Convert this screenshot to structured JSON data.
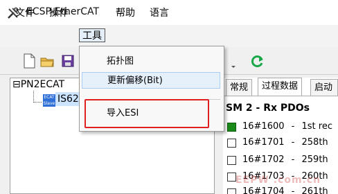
{
  "window": {
    "title": "ECSP-EtherCAT",
    "app_icon": "tools-icon"
  },
  "menubar": {
    "items": [
      {
        "label": "文件"
      },
      {
        "label": "操作"
      },
      {
        "label": "工具"
      },
      {
        "label": "帮助"
      },
      {
        "label": "语言"
      }
    ]
  },
  "toolbar": {
    "icons": [
      "new-file-icon",
      "open-folder-icon",
      "save-icon",
      "refresh-icon"
    ]
  },
  "tools_menu": {
    "items": [
      {
        "label": "拓扑图"
      },
      {
        "label": "更新偏移(Bit)"
      },
      {
        "label": "导入ESI"
      }
    ]
  },
  "tree": {
    "root_label": "PN2ECAT",
    "child_label": "IS62",
    "device_icon_text": "ECAT Slave"
  },
  "right_panel": {
    "tabs": [
      {
        "label": "常规"
      },
      {
        "label": "过程数据"
      },
      {
        "label": "启动"
      }
    ],
    "section_title": "SM 2 - Rx PDOs",
    "pdos": [
      {
        "index": "16#1600",
        "sep": "-",
        "name": "1st rec",
        "checked": true
      },
      {
        "index": "16#1701",
        "sep": "-",
        "name": "258th",
        "checked": false
      },
      {
        "index": "16#1702",
        "sep": "-",
        "name": "259th",
        "checked": false
      },
      {
        "index": "16#1703",
        "sep": "-",
        "name": "260th",
        "checked": false
      },
      {
        "index": "16#1704",
        "sep": "-",
        "name": "261th",
        "checked": false
      }
    ]
  },
  "watermark": "EEPW .com.cn",
  "colors": {
    "highlight": "#e02020",
    "checked": "#1a8a1a",
    "selection": "#cce4ff"
  }
}
